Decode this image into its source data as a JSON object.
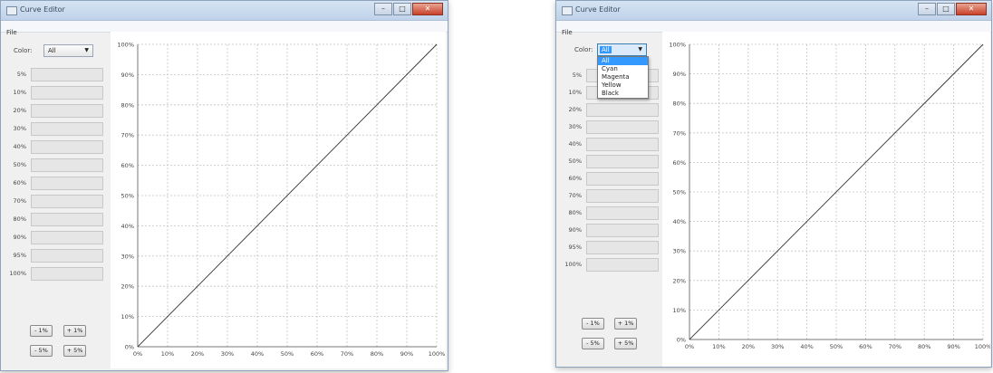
{
  "windows": [
    {
      "title": "Curve Editor",
      "menu": {
        "file": "File"
      },
      "color_label": "Color:",
      "color_value": "All",
      "dropdown_open": false,
      "levels": [
        "5%",
        "10%",
        "20%",
        "30%",
        "40%",
        "50%",
        "60%",
        "70%",
        "80%",
        "90%",
        "95%",
        "100%"
      ],
      "buttons": {
        "minus1": "- 1%",
        "plus1": "+ 1%",
        "minus5": "- 5%",
        "plus5": "+ 5%"
      }
    },
    {
      "title": "Curve Editor",
      "menu": {
        "file": "File"
      },
      "color_label": "Color:",
      "color_value": "All",
      "dropdown_open": true,
      "color_options": [
        "All",
        "Cyan",
        "Magenta",
        "Yellow",
        "Black"
      ],
      "levels": [
        "5%",
        "10%",
        "20%",
        "30%",
        "40%",
        "50%",
        "60%",
        "70%",
        "80%",
        "90%",
        "95%",
        "100%"
      ],
      "buttons": {
        "minus1": "- 1%",
        "plus1": "+ 1%",
        "minus5": "- 5%",
        "plus5": "+ 5%"
      }
    }
  ],
  "chart_data": [
    {
      "type": "line",
      "x_ticks": [
        "0%",
        "10%",
        "20%",
        "30%",
        "40%",
        "50%",
        "60%",
        "70%",
        "80%",
        "90%",
        "100%"
      ],
      "y_ticks": [
        "0%",
        "10%",
        "20%",
        "30%",
        "40%",
        "50%",
        "60%",
        "70%",
        "80%",
        "90%",
        "100%"
      ],
      "xlim": [
        0,
        100
      ],
      "ylim": [
        0,
        100
      ],
      "grid": true,
      "series": [
        {
          "x": [
            0,
            100
          ],
          "y": [
            0,
            100
          ]
        }
      ]
    },
    {
      "type": "line",
      "x_ticks": [
        "0%",
        "10%",
        "20%",
        "30%",
        "40%",
        "50%",
        "60%",
        "70%",
        "80%",
        "90%",
        "100%"
      ],
      "y_ticks": [
        "0%",
        "10%",
        "20%",
        "30%",
        "40%",
        "50%",
        "60%",
        "70%",
        "80%",
        "90%",
        "100%"
      ],
      "xlim": [
        0,
        100
      ],
      "ylim": [
        0,
        100
      ],
      "grid": true,
      "series": [
        {
          "x": [
            0,
            100
          ],
          "y": [
            0,
            100
          ]
        }
      ]
    }
  ],
  "window_controls": {
    "minimize": "–",
    "maximize": "□",
    "close": "✕"
  }
}
